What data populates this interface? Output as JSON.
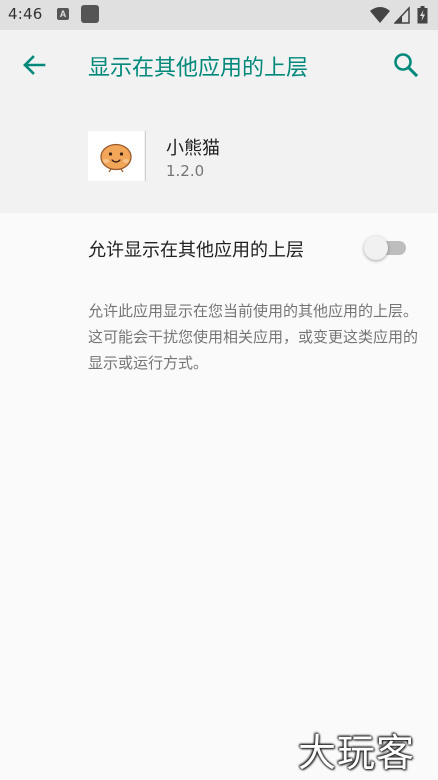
{
  "status_bar": {
    "time": "4:46",
    "left_icons": [
      "android-a-icon",
      "square-notification-icon"
    ],
    "right_icons": [
      "wifi-icon",
      "cellular-signal-icon",
      "battery-charging-icon"
    ]
  },
  "toolbar": {
    "title": "显示在其他应用的上层",
    "back_icon": "arrow-back-icon",
    "search_icon": "search-icon",
    "accent_color": "#00897b"
  },
  "app": {
    "name": "小熊猫",
    "version": "1.2.0",
    "icon": "smiling-face-app-icon"
  },
  "setting": {
    "label": "允许显示在其他应用的上层",
    "enabled": false
  },
  "description": "允许此应用显示在您当前使用的其他应用的上层。这可能会干扰您使用相关应用，或变更这类应用的显示或运行方式。",
  "watermark": "大玩客"
}
